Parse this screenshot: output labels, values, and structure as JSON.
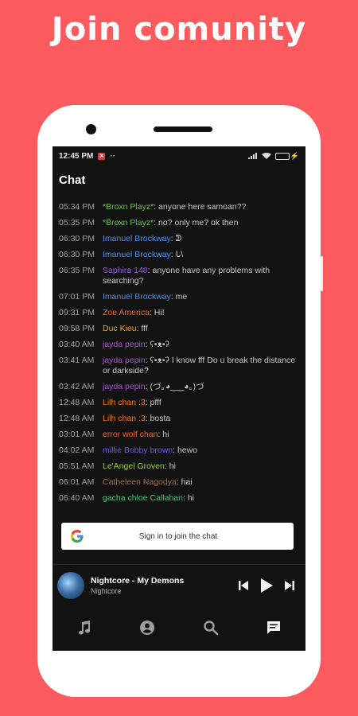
{
  "headline": "Join comunity",
  "status": {
    "time": "12:45 PM",
    "badge": "✕",
    "dots": "··",
    "battery_level": 0.75
  },
  "chat": {
    "title": "Chat",
    "messages": [
      {
        "time": "05:34 PM",
        "user": "*Broxn Playz*",
        "color": "#6cc04a",
        "text": ": anyone here samoan??"
      },
      {
        "time": "05:35 PM",
        "user": "*Broxn Playz*",
        "color": "#6cc04a",
        "text": ": no? only me? ok then"
      },
      {
        "time": "06:30 PM",
        "user": "Imanuel Brockway",
        "color": "#4c8fe8",
        "text": ": ᕲ"
      },
      {
        "time": "06:30 PM",
        "user": "Imanuel Brockway",
        "color": "#4c8fe8",
        "text": ": ᒐ\\"
      },
      {
        "time": "06:35 PM",
        "user": "Saphira 148",
        "color": "#8f5cd6",
        "text": ": anyone have any problems with searching?"
      },
      {
        "time": "07:01 PM",
        "user": "Imanuel Brockway",
        "color": "#4c8fe8",
        "text": ": me"
      },
      {
        "time": "09:31 PM",
        "user": "Zoe America",
        "color": "#f0642e",
        "text": ": Hi!"
      },
      {
        "time": "09:58 PM",
        "user": "Duc Kieu",
        "color": "#f0a020",
        "text": ": fff"
      },
      {
        "time": "03:40 AM",
        "user": "jayda pepin",
        "color": "#b04fd8",
        "text": ": ʕ•ᴥ•ʔ"
      },
      {
        "time": "03:41 AM",
        "user": "jayda pepin",
        "color": "#b04fd8",
        "text": ": ʕ•ᴥ•ʔ I know fff Do u break the distance or darkside?"
      },
      {
        "time": "03:42 AM",
        "user": "jayda pepin",
        "color": "#b04fd8",
        "text": ": (づ｡◕‿‿◕｡)づ"
      },
      {
        "time": "12:48 AM",
        "user": "Lilh chan :3",
        "color": "#f07a18",
        "text": ": pfff"
      },
      {
        "time": "12:48 AM",
        "user": "Lilh chan :3",
        "color": "#f07a18",
        "text": ": bosta"
      },
      {
        "time": "03:01 AM",
        "user": "error wolf chan",
        "color": "#f0642e",
        "text": ": hi"
      },
      {
        "time": "04:02 AM",
        "user": "millie Bobby brown",
        "color": "#6a5cd6",
        "text": ": hewo"
      },
      {
        "time": "05:51 AM",
        "user": "Le'Angel Groven",
        "color": "#9ccc3a",
        "text": ": hi"
      },
      {
        "time": "06:01 AM",
        "user": "Catheleen Nagodya",
        "color": "#9c7050",
        "text": ": hai"
      },
      {
        "time": "06:40 AM",
        "user": "gacha chloe Callahan",
        "color": "#4cc07a",
        "text": ": hi"
      }
    ]
  },
  "signin": {
    "label": "Sign in to join the chat"
  },
  "player": {
    "title": "Nightcore - My Demons",
    "artist": "Nightcore"
  }
}
